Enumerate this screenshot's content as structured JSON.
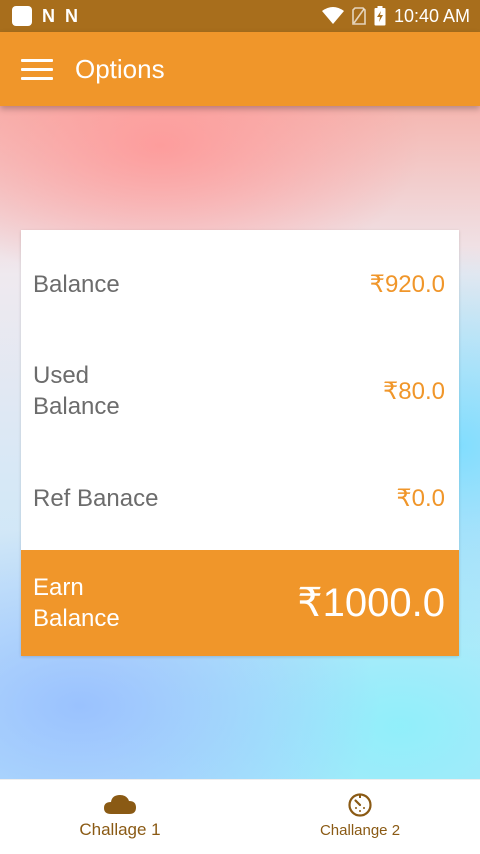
{
  "status_bar": {
    "time": "10:40 AM",
    "left_icons": [
      "app-square-icon",
      "n-icon",
      "n-icon"
    ],
    "right_icons": [
      "wifi-icon",
      "sim-icon",
      "battery-charging-icon"
    ],
    "n_glyph": "N"
  },
  "app_bar": {
    "title": "Options",
    "menu_icon": "hamburger-menu-icon"
  },
  "card": {
    "rows": [
      {
        "label": "Balance",
        "value": "₹920.0"
      },
      {
        "label_line1": "Used",
        "label_line2": "Balance",
        "value": "₹80.0"
      },
      {
        "label": "Ref Banace",
        "value": "₹0.0"
      }
    ],
    "earn": {
      "label_line1": "Earn",
      "label_line2": "Balance",
      "value": "₹1000.0"
    }
  },
  "bottom_nav": {
    "items": [
      {
        "label": "Challage 1",
        "icon": "cloud-icon"
      },
      {
        "label": "Challange 2",
        "icon": "timer-icon"
      }
    ]
  },
  "colors": {
    "status_bar": "#a86e1c",
    "accent": "#f0962a",
    "label_text": "#6c6c6c",
    "nav_text": "#8a5a14"
  }
}
